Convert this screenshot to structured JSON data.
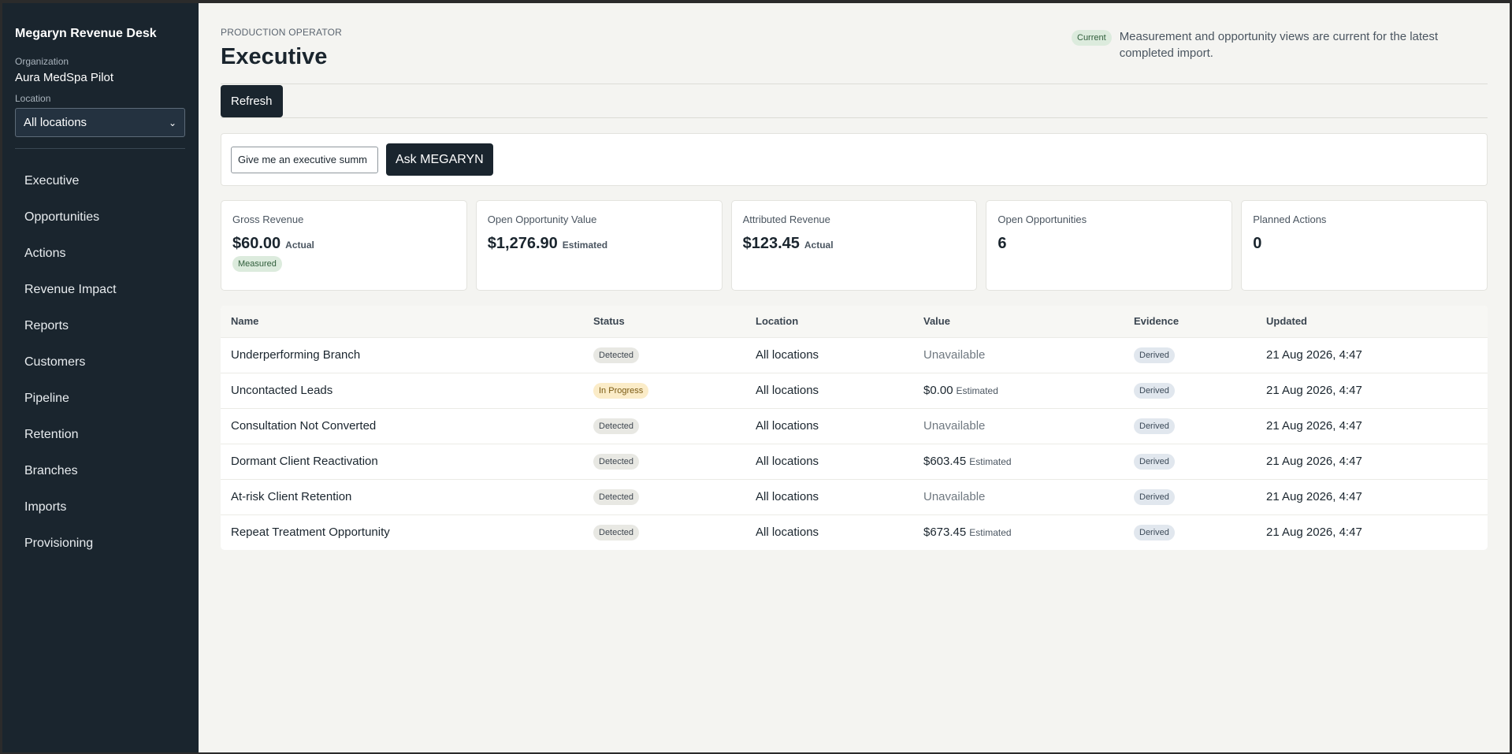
{
  "sidebar": {
    "brand": "Megaryn Revenue Desk",
    "org_label": "Organization",
    "org_name": "Aura MedSpa Pilot",
    "location_label": "Location",
    "location_selected": "All locations",
    "nav": [
      "Executive",
      "Opportunities",
      "Actions",
      "Revenue Impact",
      "Reports",
      "Customers",
      "Pipeline",
      "Retention",
      "Branches",
      "Imports",
      "Provisioning"
    ]
  },
  "header": {
    "eyebrow": "PRODUCTION OPERATOR",
    "title": "Executive",
    "freshness_badge": "Current",
    "freshness_text": "Measurement and opportunity views are current for the latest completed import."
  },
  "toolbar": {
    "refresh_label": "Refresh"
  },
  "ask": {
    "input_value": "Give me an executive summ",
    "button_label": "Ask MEGARYN"
  },
  "cards": [
    {
      "label": "Gross Revenue",
      "value": "$60.00",
      "qualifier": "Actual",
      "badge": "Measured"
    },
    {
      "label": "Open Opportunity Value",
      "value": "$1,276.90",
      "qualifier": "Estimated"
    },
    {
      "label": "Attributed Revenue",
      "value": "$123.45",
      "qualifier": "Actual"
    },
    {
      "label": "Open Opportunities",
      "value": "6"
    },
    {
      "label": "Planned Actions",
      "value": "0"
    }
  ],
  "table": {
    "columns": [
      "Name",
      "Status",
      "Location",
      "Value",
      "Evidence",
      "Updated"
    ],
    "rows": [
      {
        "name": "Underperforming Branch",
        "status": "Detected",
        "location": "All locations",
        "value": "Unavailable",
        "value_note": "",
        "evidence": "Derived",
        "updated": "21 Aug 2026, 4:47"
      },
      {
        "name": "Uncontacted Leads",
        "status": "In Progress",
        "location": "All locations",
        "value": "$0.00",
        "value_note": "Estimated",
        "evidence": "Derived",
        "updated": "21 Aug 2026, 4:47"
      },
      {
        "name": "Consultation Not Converted",
        "status": "Detected",
        "location": "All locations",
        "value": "Unavailable",
        "value_note": "",
        "evidence": "Derived",
        "updated": "21 Aug 2026, 4:47"
      },
      {
        "name": "Dormant Client Reactivation",
        "status": "Detected",
        "location": "All locations",
        "value": "$603.45",
        "value_note": "Estimated",
        "evidence": "Derived",
        "updated": "21 Aug 2026, 4:47"
      },
      {
        "name": "At-risk Client Retention",
        "status": "Detected",
        "location": "All locations",
        "value": "Unavailable",
        "value_note": "",
        "evidence": "Derived",
        "updated": "21 Aug 2026, 4:47"
      },
      {
        "name": "Repeat Treatment Opportunity",
        "status": "Detected",
        "location": "All locations",
        "value": "$673.45",
        "value_note": "Estimated",
        "evidence": "Derived",
        "updated": "21 Aug 2026, 4:47"
      }
    ]
  }
}
